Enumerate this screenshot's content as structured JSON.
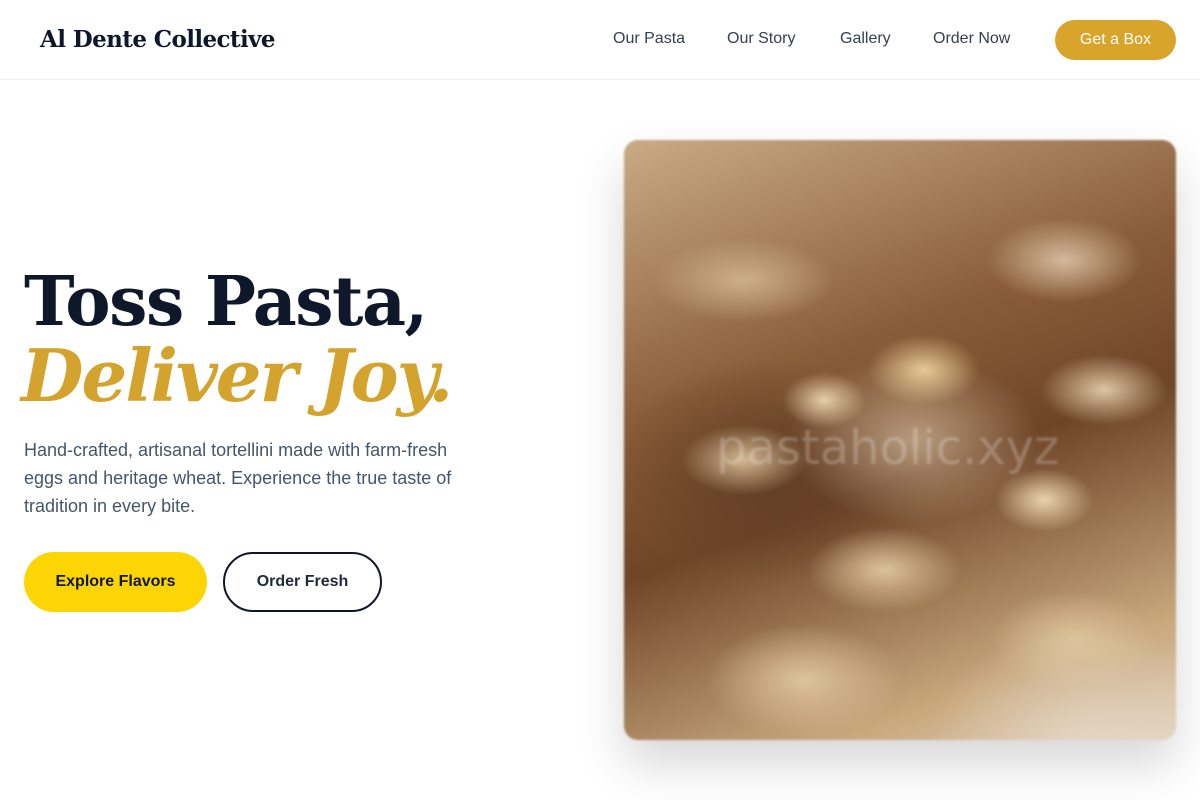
{
  "brand": {
    "logo_text": "Al Dente Collective"
  },
  "nav": {
    "items": [
      {
        "label": "Our Pasta"
      },
      {
        "label": "Our Story"
      },
      {
        "label": "Gallery"
      },
      {
        "label": "Order Now"
      }
    ],
    "cta_label": "Get a Box"
  },
  "hero": {
    "title_line1": "Toss Pasta,",
    "title_line2": "Deliver Joy.",
    "description": "Hand-crafted, artisanal tortellini made with farm-fresh eggs and heritage wheat. Experience the true taste of tradition in every bite.",
    "primary_button": "Explore Flavors",
    "secondary_button": "Order Fresh",
    "image_watermark": "pastaholic.xyz"
  },
  "colors": {
    "accent_gold": "#d9a42a",
    "title_italic": "#d4a32d",
    "primary_button": "#fdd404",
    "dark_text": "#0f172a"
  }
}
